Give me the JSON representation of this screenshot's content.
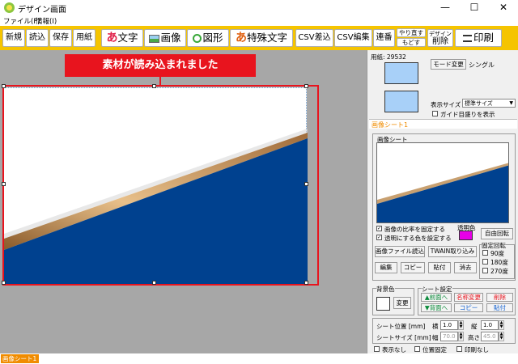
{
  "window": {
    "title": "デザイン画面",
    "minimize": "—",
    "maximize": "☐",
    "close": "✕"
  },
  "menu": {
    "file": "ファイル(F)",
    "info": "情報(I)"
  },
  "toolbar": {
    "new": "新規",
    "load": "読込",
    "save": "保存",
    "paper": "用紙",
    "text_icon": "あ",
    "text": "文字",
    "image": "画像",
    "shape": "図形",
    "special_icon": "あ",
    "special": "特殊文字",
    "csv_insert": "CSV差込",
    "csv_edit": "CSV編集",
    "serial": "連番",
    "redo": "やり直す",
    "undo": "もどす",
    "design": "デザイン",
    "delete": "削除",
    "print": "印刷"
  },
  "tooltip": "素材が読み込まれました",
  "panel": {
    "paper_label": "用紙: 29532",
    "mode_button": "モード変更",
    "mode_value": "シングル",
    "display_size_label": "表示サイズ",
    "display_size_value": "標準サイズ",
    "guide_checkbox": "ガイド目盛りを表示",
    "sheet_title": "画像シート1",
    "sheet_box_label": "画像シート",
    "keep_ratio": "画像の比率を固定する",
    "transparent_set": "透明にする色を設定する",
    "transparent_color_label": "透明色",
    "transparent_color": "#e600e6",
    "free_rotate": "自由回転",
    "load_image_file": "画像ファイル読込",
    "twain": "TWAIN取り込み",
    "fixed_rotate_label": "固定回転",
    "rot90": "90度",
    "rot180": "180度",
    "rot270": "270度",
    "edit": "編集",
    "copy": "コピー",
    "paste": "貼付",
    "erase": "消去",
    "bg_color_label": "背景色",
    "bg_change": "変更",
    "sheet_settings_label": "シート設定",
    "to_front": "▲前面へ",
    "to_back": "▼背面へ",
    "rename": "名称変更",
    "sheet_copy": "コピー",
    "sheet_delete": "削除",
    "sheet_paste": "貼付",
    "pos_label": "シート位置 [mm]",
    "horiz_label": "横",
    "horiz_value": "1.0",
    "vert_label": "縦",
    "vert_value": "1.0",
    "size_label": "シートサイズ [mm]",
    "width_label": "幅",
    "width_value": "70.0",
    "height_label": "高さ",
    "height_value": "45.0",
    "hide": "表示なし",
    "lock_pos": "位置固定",
    "no_print": "印刷なし"
  },
  "status": {
    "tab": "画像シート1"
  },
  "colors": {
    "toolbar": "#f5c400",
    "accent_red": "#e8141e",
    "blue": "#00418f",
    "tab_orange": "#f08c00"
  }
}
